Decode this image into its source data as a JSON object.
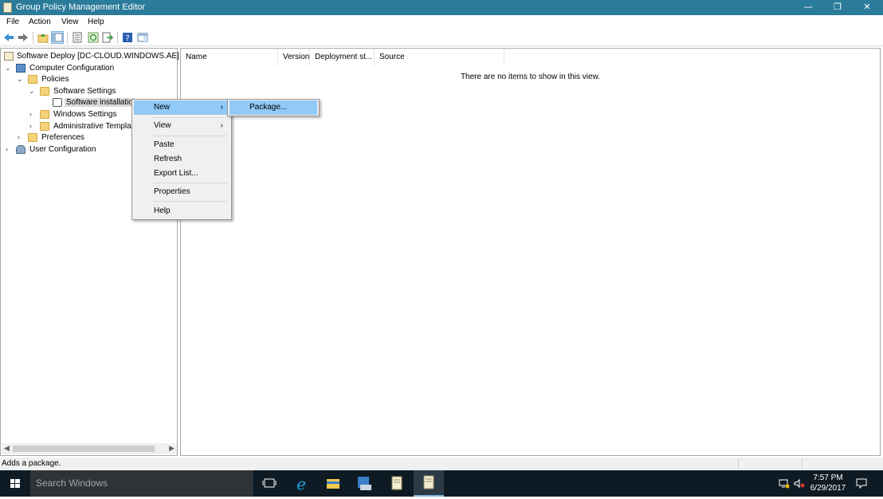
{
  "window": {
    "title": "Group Policy Management Editor",
    "controls": [
      "—",
      "❐",
      "✕"
    ]
  },
  "menubar": [
    "File",
    "Action",
    "View",
    "Help"
  ],
  "tree": {
    "root": "Software Deploy [DC-CLOUD.WINDOWS.AE] Po",
    "computer_configuration": "Computer Configuration",
    "policies": "Policies",
    "software_settings": "Software Settings",
    "software_installation": "Software installatio",
    "windows_settings": "Windows Settings",
    "administrative_templates": "Administrative Templat",
    "preferences": "Preferences",
    "user_configuration": "User Configuration"
  },
  "list": {
    "columns": [
      "Name",
      "Version",
      "Deployment st...",
      "Source"
    ],
    "empty_message": "There are no items to show in this view."
  },
  "context_menu": {
    "items": [
      {
        "label": "New",
        "submenu": true
      },
      {
        "label": "View",
        "submenu": true
      },
      {
        "label": "Paste"
      },
      {
        "label": "Refresh"
      },
      {
        "label": "Export List..."
      },
      {
        "label": "Properties"
      },
      {
        "label": "Help"
      }
    ],
    "submenu_arrow": "›",
    "new_submenu": [
      "Package..."
    ]
  },
  "status": {
    "text": "Adds a package."
  },
  "taskbar": {
    "search_placeholder": "Search Windows",
    "time": "7:57 PM",
    "date": "6/29/2017"
  },
  "colors": {
    "titlebar": "#2b7b9b",
    "menu_highlight": "#91c9f7",
    "taskbar": "#0f1b24"
  }
}
